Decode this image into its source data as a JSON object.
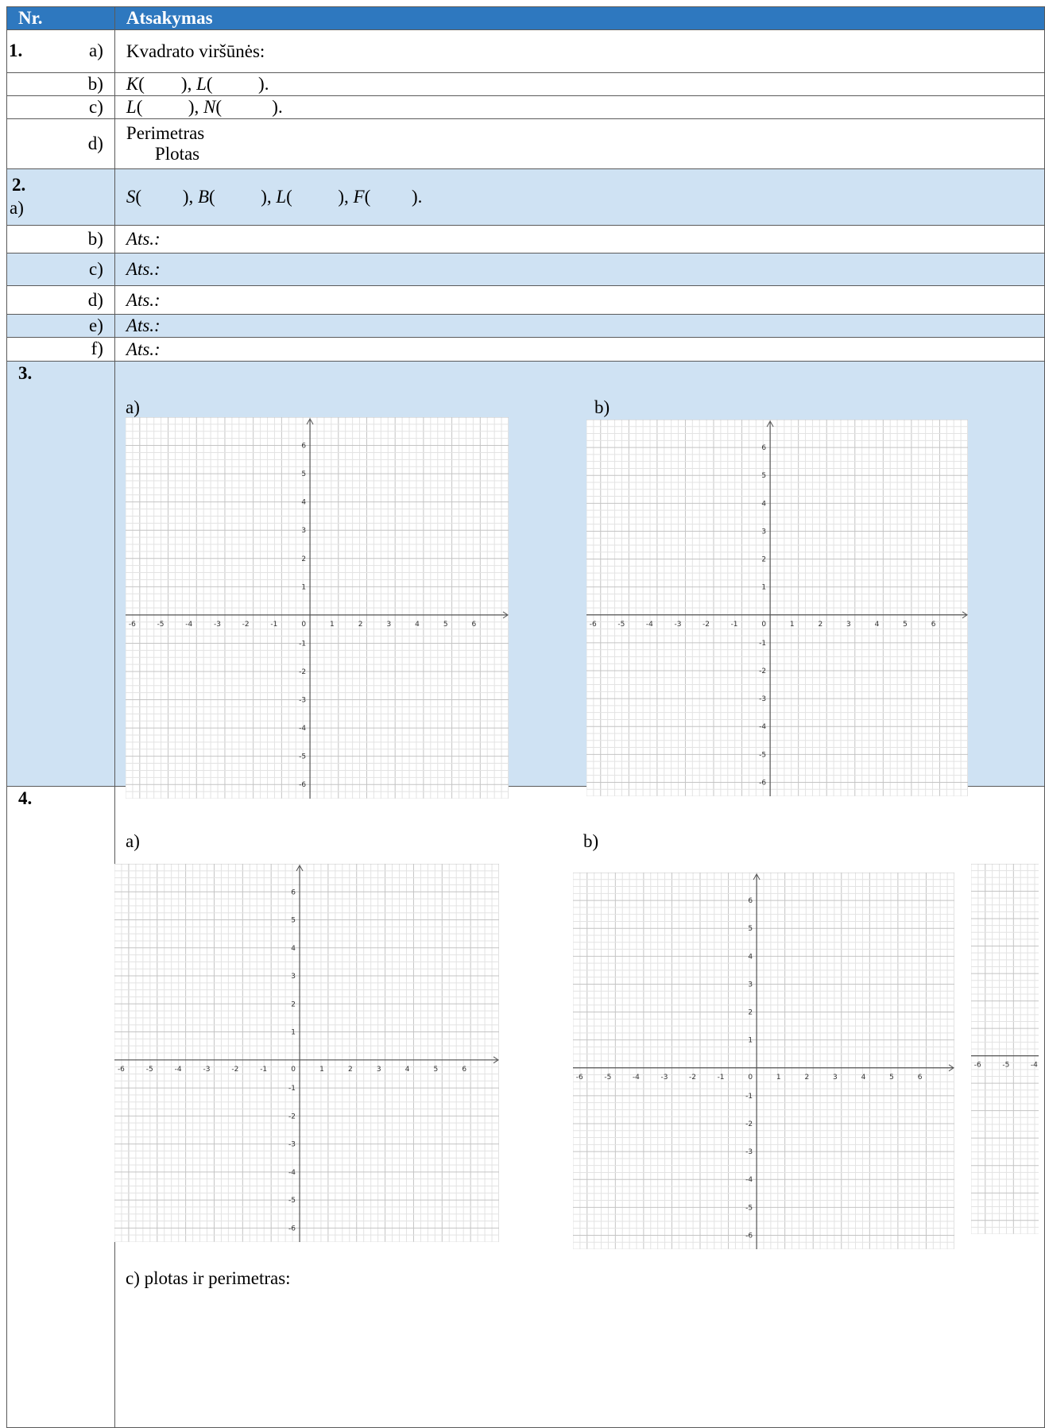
{
  "header": {
    "nr": "Nr.",
    "answer": "Atsakymas"
  },
  "task1": {
    "number": "1.",
    "a": {
      "label": "a)",
      "text": "Kvadrato viršūnės:"
    },
    "b": {
      "label": "b)",
      "p1": "K",
      "p1_rest": "(        ),",
      "p2": "L",
      "p2_rest": "(          )."
    },
    "c": {
      "label": "c)",
      "p1": "L",
      "p1_rest": "(          ),",
      "p2": "N",
      "p2_rest": "(           )."
    },
    "d": {
      "label": "d)",
      "line1": "Perimetras",
      "line2": "Plotas"
    }
  },
  "task2": {
    "number": "2.",
    "a": {
      "label": "a)",
      "p1": "S",
      "p1_rest": "(         ),",
      "p2": "B",
      "p2_rest": "(          ),",
      "p3": "L",
      "p3_rest": "(          ),",
      "p4": "F",
      "p4_rest": "(         )."
    },
    "rows": [
      {
        "label": "b)",
        "text": "Ats.:"
      },
      {
        "label": "c)",
        "text": "Ats.:"
      },
      {
        "label": "d)",
        "text": "Ats.:"
      },
      {
        "label": "e)",
        "text": "Ats.:"
      },
      {
        "label": "f)",
        "text": "Ats.:"
      }
    ]
  },
  "task3": {
    "number": "3.",
    "a_label": "a)",
    "b_label": "b)"
  },
  "task4": {
    "number": "4.",
    "a_label": "a)",
    "b_label": "b)",
    "c_text": "c) plotas ir perimetras:"
  },
  "coordinate_grid": {
    "x_ticks": [
      "-6",
      "-5",
      "-4",
      "-3",
      "-2",
      "-1",
      "0",
      "1",
      "2",
      "3",
      "4",
      "5",
      "6"
    ],
    "y_ticks": [
      "6",
      "5",
      "4",
      "3",
      "2",
      "1",
      "-1",
      "-2",
      "-3",
      "-4",
      "-5",
      "-6"
    ],
    "xlim": [
      -6.5,
      7
    ],
    "ylim": [
      -6.5,
      7
    ]
  },
  "colors": {
    "header": "#2e78bf",
    "band": "#cfe2f3",
    "grid_minor": "#e3e3e3",
    "grid_major": "#c4c4c4"
  }
}
